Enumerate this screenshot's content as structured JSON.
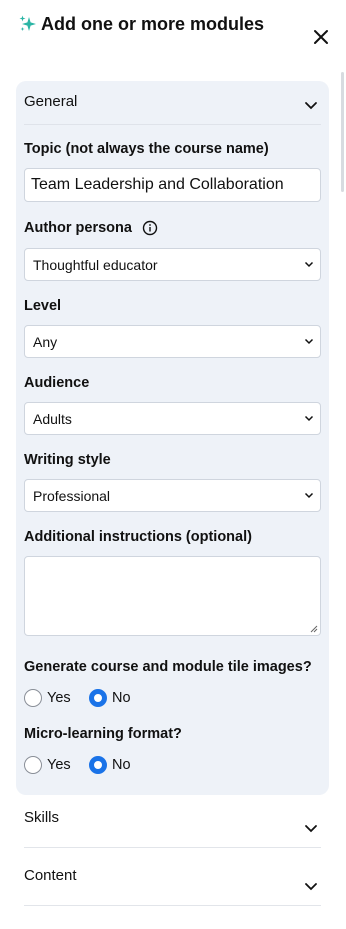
{
  "header": {
    "title": "Add one or more modules",
    "accent_color": "#2bb5a5",
    "sparkle_icon": "sparkle-icon",
    "close_icon": "close-icon"
  },
  "general": {
    "label": "General",
    "expanded": true,
    "topic": {
      "label": "Topic (not always the course name)",
      "value": "Team Leadership and Collaboration"
    },
    "author_persona": {
      "label": "Author persona",
      "value": "Thoughtful educator",
      "info_icon": "info-icon"
    },
    "level": {
      "label": "Level",
      "value": "Any"
    },
    "audience": {
      "label": "Audience",
      "value": "Adults"
    },
    "writing_style": {
      "label": "Writing style",
      "value": "Professional"
    },
    "additional_instructions": {
      "label": "Additional instructions (optional)",
      "value": ""
    },
    "tile_images": {
      "label": "Generate course and module tile images?",
      "options": [
        "Yes",
        "No"
      ],
      "selected": "No"
    },
    "micro_learning": {
      "label": "Micro-learning format?",
      "options": [
        "Yes",
        "No"
      ],
      "selected": "No"
    }
  },
  "sections": [
    {
      "label": "Skills",
      "expanded": false
    },
    {
      "label": "Content",
      "expanded": false
    }
  ],
  "colors": {
    "panel_bg": "#eef2f8",
    "radio_selected": "#1a73e8"
  }
}
